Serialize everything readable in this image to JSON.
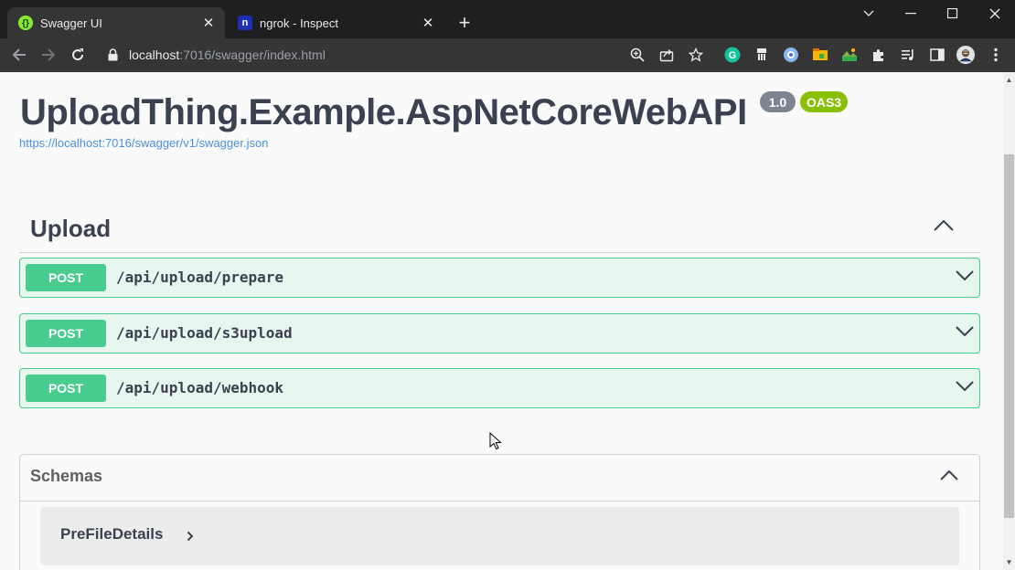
{
  "browser": {
    "tabs": [
      {
        "title": "Swagger UI",
        "favicon": "swagger-icon",
        "active": true
      },
      {
        "title": "ngrok - Inspect",
        "favicon": "ngrok-icon",
        "active": false
      }
    ],
    "url_host": "localhost",
    "url_path": ":7016/swagger/index.html"
  },
  "page": {
    "api_title": "UploadThing.Example.AspNetCoreWebAPI",
    "version_badge": "1.0",
    "oas_badge": "OAS3",
    "spec_url": "https://localhost:7016/swagger/v1/swagger.json",
    "section": {
      "title": "Upload",
      "operations": [
        {
          "method": "POST",
          "path": "/api/upload/prepare"
        },
        {
          "method": "POST",
          "path": "/api/upload/s3upload"
        },
        {
          "method": "POST",
          "path": "/api/upload/webhook"
        }
      ]
    },
    "schemas": {
      "title": "Schemas",
      "models": [
        {
          "name": "PreFileDetails"
        }
      ]
    }
  },
  "colors": {
    "post_green": "#49cc90",
    "post_bg": "#e8f6f0",
    "oas_badge": "#89bf04",
    "version_badge": "#7d8492",
    "link": "#4990e2",
    "chrome_dark": "#1f1f1f",
    "chrome_toolbar": "#353535"
  }
}
